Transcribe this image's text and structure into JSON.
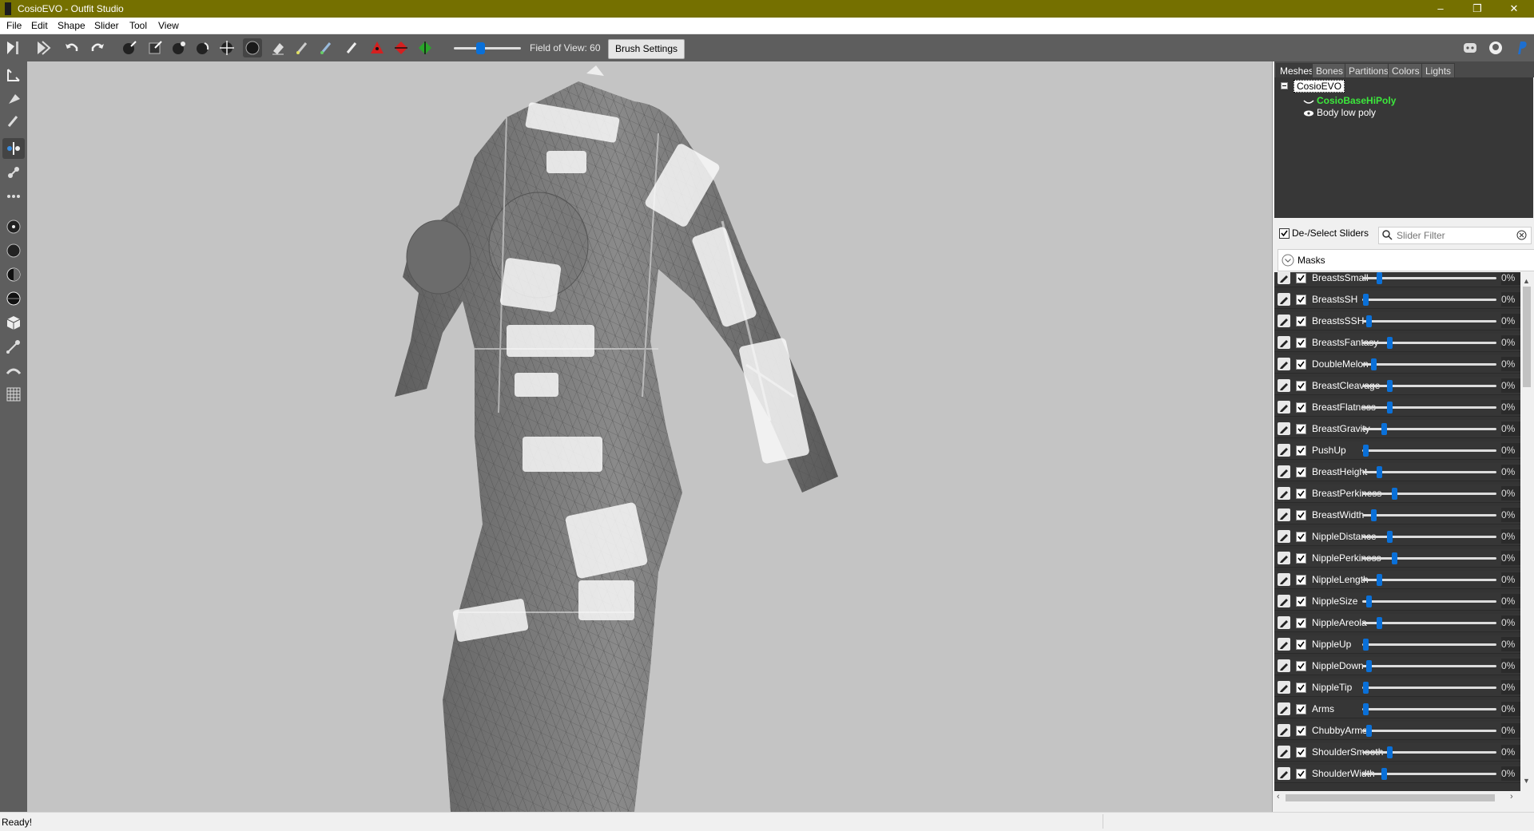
{
  "window": {
    "title": "CosioEVO - Outfit Studio",
    "minimize": "–",
    "restore": "❐",
    "close": "✕"
  },
  "menu": [
    "File",
    "Edit",
    "Shape",
    "Slider",
    "Tool",
    "View"
  ],
  "toolbar": {
    "fov_label": "Field of View: 60",
    "fov_value": 60,
    "brush_settings": "Brush Settings"
  },
  "tabs": [
    {
      "label": "Meshes",
      "active": true
    },
    {
      "label": "Bones",
      "active": false
    },
    {
      "label": "Partitions",
      "active": false
    },
    {
      "label": "Colors",
      "active": false
    },
    {
      "label": "Lights",
      "active": false
    }
  ],
  "mesh_tree": {
    "root": "CosioEVO",
    "children": [
      {
        "label": "CosioBaseHiPoly",
        "color": "#3ce83c"
      },
      {
        "label": "Body low poly",
        "color": "#ffffff"
      }
    ]
  },
  "sliders_panel": {
    "deselect_label": "De-/Select Sliders",
    "filter_placeholder": "Slider Filter",
    "masks_label": "Masks"
  },
  "sliders": [
    {
      "name": "BreastsSmall",
      "value": "0%",
      "pos": 0.0
    },
    {
      "name": "BreastsSH",
      "value": "0%",
      "pos": 0.0
    },
    {
      "name": "BreastsSSH",
      "value": "0%",
      "pos": 0.0
    },
    {
      "name": "BreastsFantasy",
      "value": "0%",
      "pos": 0.0
    },
    {
      "name": "DoubleMelon",
      "value": "0%",
      "pos": 0.0
    },
    {
      "name": "BreastCleavage",
      "value": "0%",
      "pos": 0.0
    },
    {
      "name": "BreastFlatness",
      "value": "0%",
      "pos": 0.0
    },
    {
      "name": "BreastGravity",
      "value": "0%",
      "pos": 0.0
    },
    {
      "name": "PushUp",
      "value": "0%",
      "pos": 0.0
    },
    {
      "name": "BreastHeight",
      "value": "0%",
      "pos": 0.0
    },
    {
      "name": "BreastPerkiness",
      "value": "0%",
      "pos": 0.0
    },
    {
      "name": "BreastWidth",
      "value": "0%",
      "pos": 0.0
    },
    {
      "name": "NippleDistance",
      "value": "0%",
      "pos": 0.0
    },
    {
      "name": "NipplePerkiness",
      "value": "0%",
      "pos": 0.0
    },
    {
      "name": "NippleLength",
      "value": "0%",
      "pos": 0.0
    },
    {
      "name": "NippleSize",
      "value": "0%",
      "pos": 0.0
    },
    {
      "name": "NippleAreola",
      "value": "0%",
      "pos": 0.0
    },
    {
      "name": "NippleUp",
      "value": "0%",
      "pos": 0.0
    },
    {
      "name": "NippleDown",
      "value": "0%",
      "pos": 0.0
    },
    {
      "name": "NippleTip",
      "value": "0%",
      "pos": 0.0
    },
    {
      "name": "Arms",
      "value": "0%",
      "pos": 0.0
    },
    {
      "name": "ChubbyArms",
      "value": "0%",
      "pos": 0.0
    },
    {
      "name": "ShoulderSmooth",
      "value": "0%",
      "pos": 0.0
    },
    {
      "name": "ShoulderWidth",
      "value": "0%",
      "pos": 0.0
    }
  ],
  "statusbar": {
    "text": "Ready!"
  },
  "colors": {
    "titlebar": "#757000",
    "accent": "#0a70d8",
    "panel_dark": "#343434"
  }
}
